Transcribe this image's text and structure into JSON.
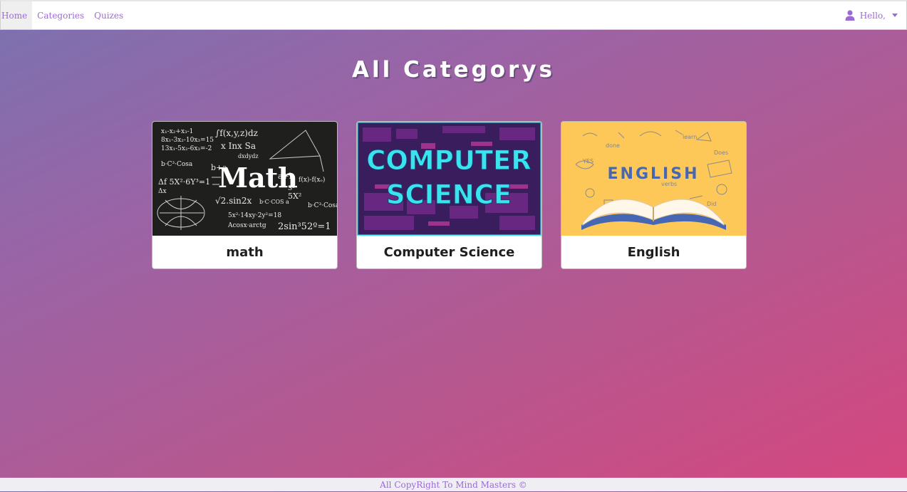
{
  "navbar": {
    "links": [
      {
        "label": "Home",
        "active": true
      },
      {
        "label": "Categories",
        "active": false
      },
      {
        "label": "Quizes",
        "active": false
      }
    ],
    "user": {
      "greeting": "Hello,",
      "icon": "user-icon"
    }
  },
  "page": {
    "title": "All Categorys"
  },
  "categories": [
    {
      "title": "math",
      "image_text": "Math"
    },
    {
      "title": "Computer Science",
      "image_text_line1": "COMPUTER",
      "image_text_line2": "SCIENCE"
    },
    {
      "title": "English",
      "image_text": "ENGLISH"
    }
  ],
  "footer": {
    "text": "All CopyRight To Mind Masters ©"
  },
  "colors": {
    "accent": "#9b6ad6",
    "math_bg": "#1f201e",
    "cs_bg": "#3a1d5c",
    "cs_text": "#39e4ee",
    "english_bg": "#fec859",
    "english_text": "#4567b4"
  }
}
